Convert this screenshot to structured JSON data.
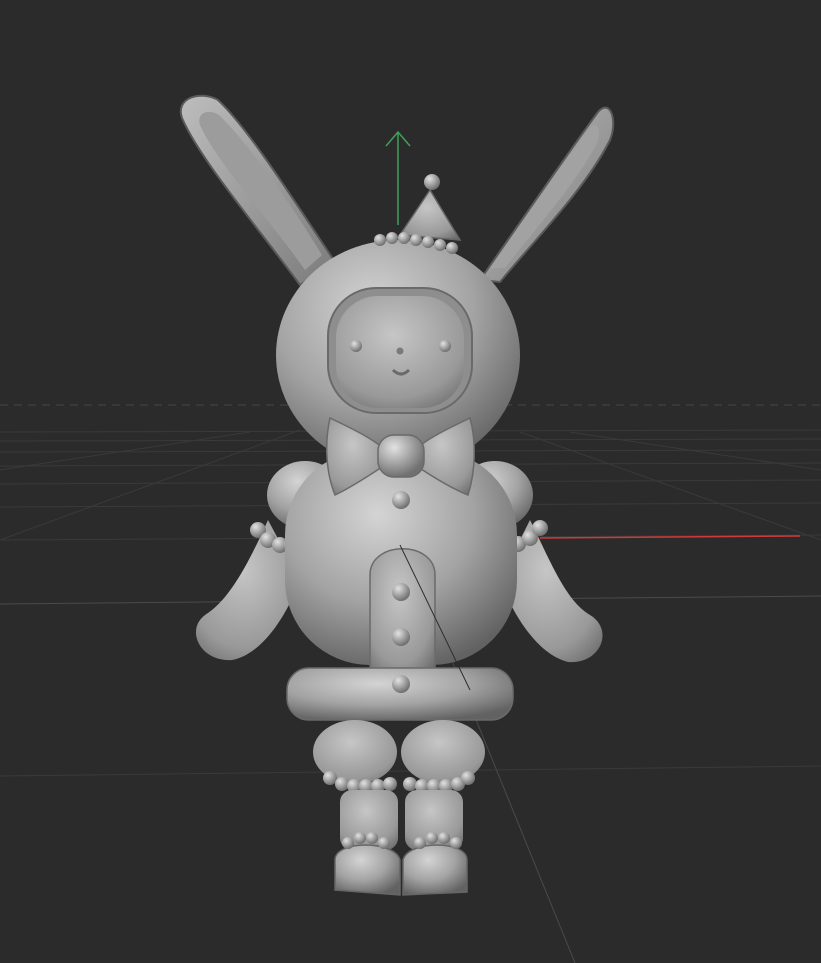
{
  "viewport": {
    "background": "#2b2b2b",
    "grid_color": "#3a3a3a",
    "x_axis_color": "#e23a3a",
    "y_axis_color": "#3fa15a",
    "model_fill": "#9a9a9a",
    "model_highlight": "#cfcfcf",
    "model_shadow": "#5e5e5e"
  },
  "model": {
    "subject": "bunny-costume-figure",
    "shading": "matcap-gray"
  },
  "gizmo": {
    "up_axis_icon": "arrow-up-icon"
  }
}
